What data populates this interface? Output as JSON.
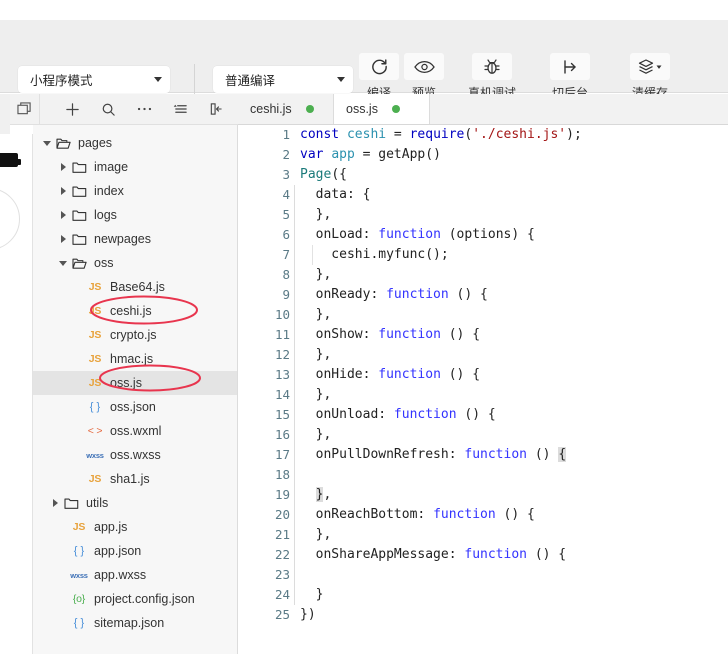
{
  "toolbar": {
    "mode_select": {
      "label": "小程序模式",
      "icon": "chevron-down-icon"
    },
    "compile_select": {
      "label": "普通编译",
      "icon": "chevron-down-icon"
    },
    "buttons": [
      {
        "label": "编译",
        "icon": "refresh-icon"
      },
      {
        "label": "预览",
        "icon": "eye-icon"
      },
      {
        "label": "真机调试",
        "icon": "bug-icon"
      },
      {
        "label": "切后台",
        "icon": "background-switch-icon"
      },
      {
        "label": "清缓存",
        "icon": "layers-icon"
      }
    ]
  },
  "sidebar": {
    "tools": [
      {
        "name": "panel-toggle-icon",
        "glyph": "panel"
      },
      {
        "name": "add-icon",
        "glyph": "plus"
      },
      {
        "name": "search-icon",
        "glyph": "search"
      },
      {
        "name": "more-icon",
        "glyph": "ellipsis"
      },
      {
        "name": "sort-icon",
        "glyph": "sort"
      },
      {
        "name": "collapse-icon",
        "glyph": "collapse"
      }
    ],
    "tree": [
      {
        "label": "pages",
        "type": "folder-open",
        "depth": 0,
        "twisty": "open",
        "selected": false
      },
      {
        "label": "image",
        "type": "folder-closed",
        "depth": 1,
        "twisty": "closed",
        "selected": false
      },
      {
        "label": "index",
        "type": "folder-closed",
        "depth": 1,
        "twisty": "closed",
        "selected": false
      },
      {
        "label": "logs",
        "type": "folder-closed",
        "depth": 1,
        "twisty": "closed",
        "selected": false
      },
      {
        "label": "newpages",
        "type": "folder-closed",
        "depth": 1,
        "twisty": "closed",
        "selected": false
      },
      {
        "label": "oss",
        "type": "folder-open",
        "depth": 1,
        "twisty": "open",
        "selected": false
      },
      {
        "label": "Base64.js",
        "type": "js",
        "depth": 2,
        "twisty": "none",
        "selected": false
      },
      {
        "label": "ceshi.js",
        "type": "js",
        "depth": 2,
        "twisty": "none",
        "selected": false,
        "annotated": true
      },
      {
        "label": "crypto.js",
        "type": "js",
        "depth": 2,
        "twisty": "none",
        "selected": false
      },
      {
        "label": "hmac.js",
        "type": "js",
        "depth": 2,
        "twisty": "none",
        "selected": false
      },
      {
        "label": "oss.js",
        "type": "js",
        "depth": 2,
        "twisty": "none",
        "selected": true,
        "annotated": true
      },
      {
        "label": "oss.json",
        "type": "json",
        "depth": 2,
        "twisty": "none",
        "selected": false
      },
      {
        "label": "oss.wxml",
        "type": "wxml",
        "depth": 2,
        "twisty": "none",
        "selected": false
      },
      {
        "label": "oss.wxss",
        "type": "wxss",
        "depth": 2,
        "twisty": "none",
        "selected": false
      },
      {
        "label": "sha1.js",
        "type": "js",
        "depth": 2,
        "twisty": "none",
        "selected": false
      },
      {
        "label": "utils",
        "type": "folder-closed",
        "depth": 0.5,
        "twisty": "closed",
        "selected": false
      },
      {
        "label": "app.js",
        "type": "js",
        "depth": 1,
        "twisty": "none",
        "selected": false
      },
      {
        "label": "app.json",
        "type": "json",
        "depth": 1,
        "twisty": "none",
        "selected": false
      },
      {
        "label": "app.wxss",
        "type": "wxss",
        "depth": 1,
        "twisty": "none",
        "selected": false
      },
      {
        "label": "project.config.json",
        "type": "config",
        "depth": 1,
        "twisty": "none",
        "selected": false
      },
      {
        "label": "sitemap.json",
        "type": "json",
        "depth": 1,
        "twisty": "none",
        "selected": false
      }
    ],
    "annotation_color": "#e8354e"
  },
  "editor": {
    "tabs": [
      {
        "label": "ceshi.js",
        "active": false,
        "modified": true
      },
      {
        "label": "oss.js",
        "active": true,
        "modified": true
      }
    ],
    "modified_dot_color": "#4caf50",
    "lines": [
      {
        "n": 1,
        "indent": 0,
        "tokens": [
          {
            "t": "const",
            "c": "kw"
          },
          {
            "t": " ",
            "c": "plain"
          },
          {
            "t": "ceshi",
            "c": "var"
          },
          {
            "t": " = ",
            "c": "plain"
          },
          {
            "t": "require",
            "c": "kw"
          },
          {
            "t": "(",
            "c": "plain"
          },
          {
            "t": "'./ceshi.js'",
            "c": "str"
          },
          {
            "t": ");",
            "c": "plain"
          }
        ]
      },
      {
        "n": 2,
        "indent": 0,
        "tokens": [
          {
            "t": "var",
            "c": "kw"
          },
          {
            "t": " ",
            "c": "plain"
          },
          {
            "t": "app",
            "c": "var"
          },
          {
            "t": " = ",
            "c": "plain"
          },
          {
            "t": "getApp()",
            "c": "plain"
          }
        ]
      },
      {
        "n": 3,
        "indent": 0,
        "tokens": [
          {
            "t": "Page",
            "c": "fn"
          },
          {
            "t": "({",
            "c": "plain"
          }
        ]
      },
      {
        "n": 4,
        "indent": 1,
        "tokens": [
          {
            "t": "  data: {",
            "c": "plain"
          }
        ]
      },
      {
        "n": 5,
        "indent": 1,
        "tokens": [
          {
            "t": "  },",
            "c": "plain"
          }
        ]
      },
      {
        "n": 6,
        "indent": 1,
        "tokens": [
          {
            "t": "  onLoad: ",
            "c": "plain"
          },
          {
            "t": "function",
            "c": "kw2"
          },
          {
            "t": " (options) {",
            "c": "plain"
          }
        ]
      },
      {
        "n": 7,
        "indent": 2,
        "tokens": [
          {
            "t": "    ceshi.myfunc();",
            "c": "plain"
          }
        ]
      },
      {
        "n": 8,
        "indent": 1,
        "tokens": [
          {
            "t": "  },",
            "c": "plain"
          }
        ]
      },
      {
        "n": 9,
        "indent": 1,
        "tokens": [
          {
            "t": "  onReady: ",
            "c": "plain"
          },
          {
            "t": "function",
            "c": "kw2"
          },
          {
            "t": " () {",
            "c": "plain"
          }
        ]
      },
      {
        "n": 10,
        "indent": 1,
        "tokens": [
          {
            "t": "  },",
            "c": "plain"
          }
        ]
      },
      {
        "n": 11,
        "indent": 1,
        "tokens": [
          {
            "t": "  onShow: ",
            "c": "plain"
          },
          {
            "t": "function",
            "c": "kw2"
          },
          {
            "t": " () {",
            "c": "plain"
          }
        ]
      },
      {
        "n": 12,
        "indent": 1,
        "tokens": [
          {
            "t": "  },",
            "c": "plain"
          }
        ]
      },
      {
        "n": 13,
        "indent": 1,
        "tokens": [
          {
            "t": "  onHide: ",
            "c": "plain"
          },
          {
            "t": "function",
            "c": "kw2"
          },
          {
            "t": " () {",
            "c": "plain"
          }
        ]
      },
      {
        "n": 14,
        "indent": 1,
        "tokens": [
          {
            "t": "  },",
            "c": "plain"
          }
        ]
      },
      {
        "n": 15,
        "indent": 1,
        "tokens": [
          {
            "t": "  onUnload: ",
            "c": "plain"
          },
          {
            "t": "function",
            "c": "kw2"
          },
          {
            "t": " () {",
            "c": "plain"
          }
        ]
      },
      {
        "n": 16,
        "indent": 1,
        "tokens": [
          {
            "t": "  },",
            "c": "plain"
          }
        ]
      },
      {
        "n": 17,
        "indent": 1,
        "tokens": [
          {
            "t": "  onPullDownRefresh: ",
            "c": "plain"
          },
          {
            "t": "function",
            "c": "kw2"
          },
          {
            "t": " () ",
            "c": "plain"
          },
          {
            "t": "{",
            "c": "brk"
          }
        ]
      },
      {
        "n": 18,
        "indent": 1,
        "tokens": []
      },
      {
        "n": 19,
        "indent": 1,
        "tokens": [
          {
            "t": "  ",
            "c": "plain"
          },
          {
            "t": "}",
            "c": "brk"
          },
          {
            "t": ",",
            "c": "plain"
          }
        ]
      },
      {
        "n": 20,
        "indent": 1,
        "tokens": [
          {
            "t": "  onReachBottom: ",
            "c": "plain"
          },
          {
            "t": "function",
            "c": "kw2"
          },
          {
            "t": " () {",
            "c": "plain"
          }
        ]
      },
      {
        "n": 21,
        "indent": 1,
        "tokens": [
          {
            "t": "  },",
            "c": "plain"
          }
        ]
      },
      {
        "n": 22,
        "indent": 1,
        "tokens": [
          {
            "t": "  onShareAppMessage: ",
            "c": "plain"
          },
          {
            "t": "function",
            "c": "kw2"
          },
          {
            "t": " () {",
            "c": "plain"
          }
        ]
      },
      {
        "n": 23,
        "indent": 1,
        "tokens": []
      },
      {
        "n": 24,
        "indent": 1,
        "tokens": [
          {
            "t": "  }",
            "c": "plain"
          }
        ]
      },
      {
        "n": 25,
        "indent": 0,
        "tokens": [
          {
            "t": "})",
            "c": "plain"
          }
        ]
      }
    ]
  }
}
